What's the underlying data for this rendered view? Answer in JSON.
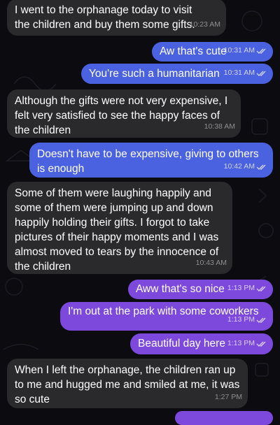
{
  "theme": {
    "background": "#0b0b10",
    "incoming_bubble": "#2a2a2c",
    "outgoing_blue": "#4a62e0",
    "outgoing_purple": "#7d49dd",
    "read_receipt_icon": "double-check-icon"
  },
  "messages": [
    {
      "direction": "incoming",
      "text": "I went to the orphanage today to visit the children and buy them some gifts.",
      "time": "10:23 AM"
    },
    {
      "direction": "outgoing",
      "text": "Aw that's cute",
      "time": "10:31 AM",
      "read": true
    },
    {
      "direction": "outgoing",
      "text": "You're such a humanitarian",
      "time": "10:31 AM",
      "read": true
    },
    {
      "direction": "incoming",
      "text": "Although the gifts were not very expensive, I felt very satisfied to see the happy faces of the children",
      "time": "10:38 AM"
    },
    {
      "direction": "outgoing",
      "text": "Doesn't have to be expensive, giving to others is enough",
      "time": "10:42 AM",
      "read": true
    },
    {
      "direction": "incoming",
      "text": "Some of them were laughing happily and some of them were jumping up and down happily holding their gifts. I forgot to take pictures of their happy moments and I was almost moved to tears by the innocence of the children",
      "time": "10:43 AM"
    },
    {
      "direction": "outgoing",
      "text": "Aww that's so nice",
      "time": "1:13 PM",
      "read": true
    },
    {
      "direction": "outgoing",
      "text": "I'm out at the park with some coworkers",
      "time": "1:13 PM",
      "read": true
    },
    {
      "direction": "outgoing",
      "text": "Beautiful day here",
      "time": "1:13 PM",
      "read": true
    },
    {
      "direction": "incoming",
      "text": "When I left the orphanage, the children ran up to me and hugged me and smiled at me, it was so cute",
      "time": "1:27 PM"
    }
  ]
}
